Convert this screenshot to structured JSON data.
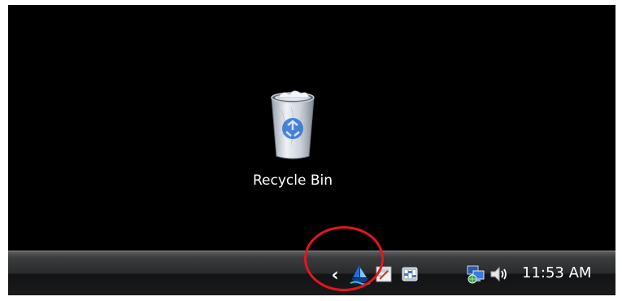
{
  "desktop": {
    "icons": [
      {
        "label": "Recycle Bin",
        "icon": "recycle-bin-icon"
      }
    ]
  },
  "taskbar": {
    "tray": {
      "show_hidden_icon": "chevron-left-icon",
      "items": [
        {
          "icon": "boat-app-icon"
        },
        {
          "icon": "document-app-icon"
        },
        {
          "icon": "settings-app-icon"
        },
        {
          "icon": "network-icon"
        },
        {
          "icon": "volume-icon"
        }
      ],
      "clock": "11:53 AM"
    }
  },
  "annotation": {
    "highlight_color": "#e3161d"
  },
  "colors": {
    "desktop_background": "#000000",
    "clock_text": "#ffffff"
  }
}
